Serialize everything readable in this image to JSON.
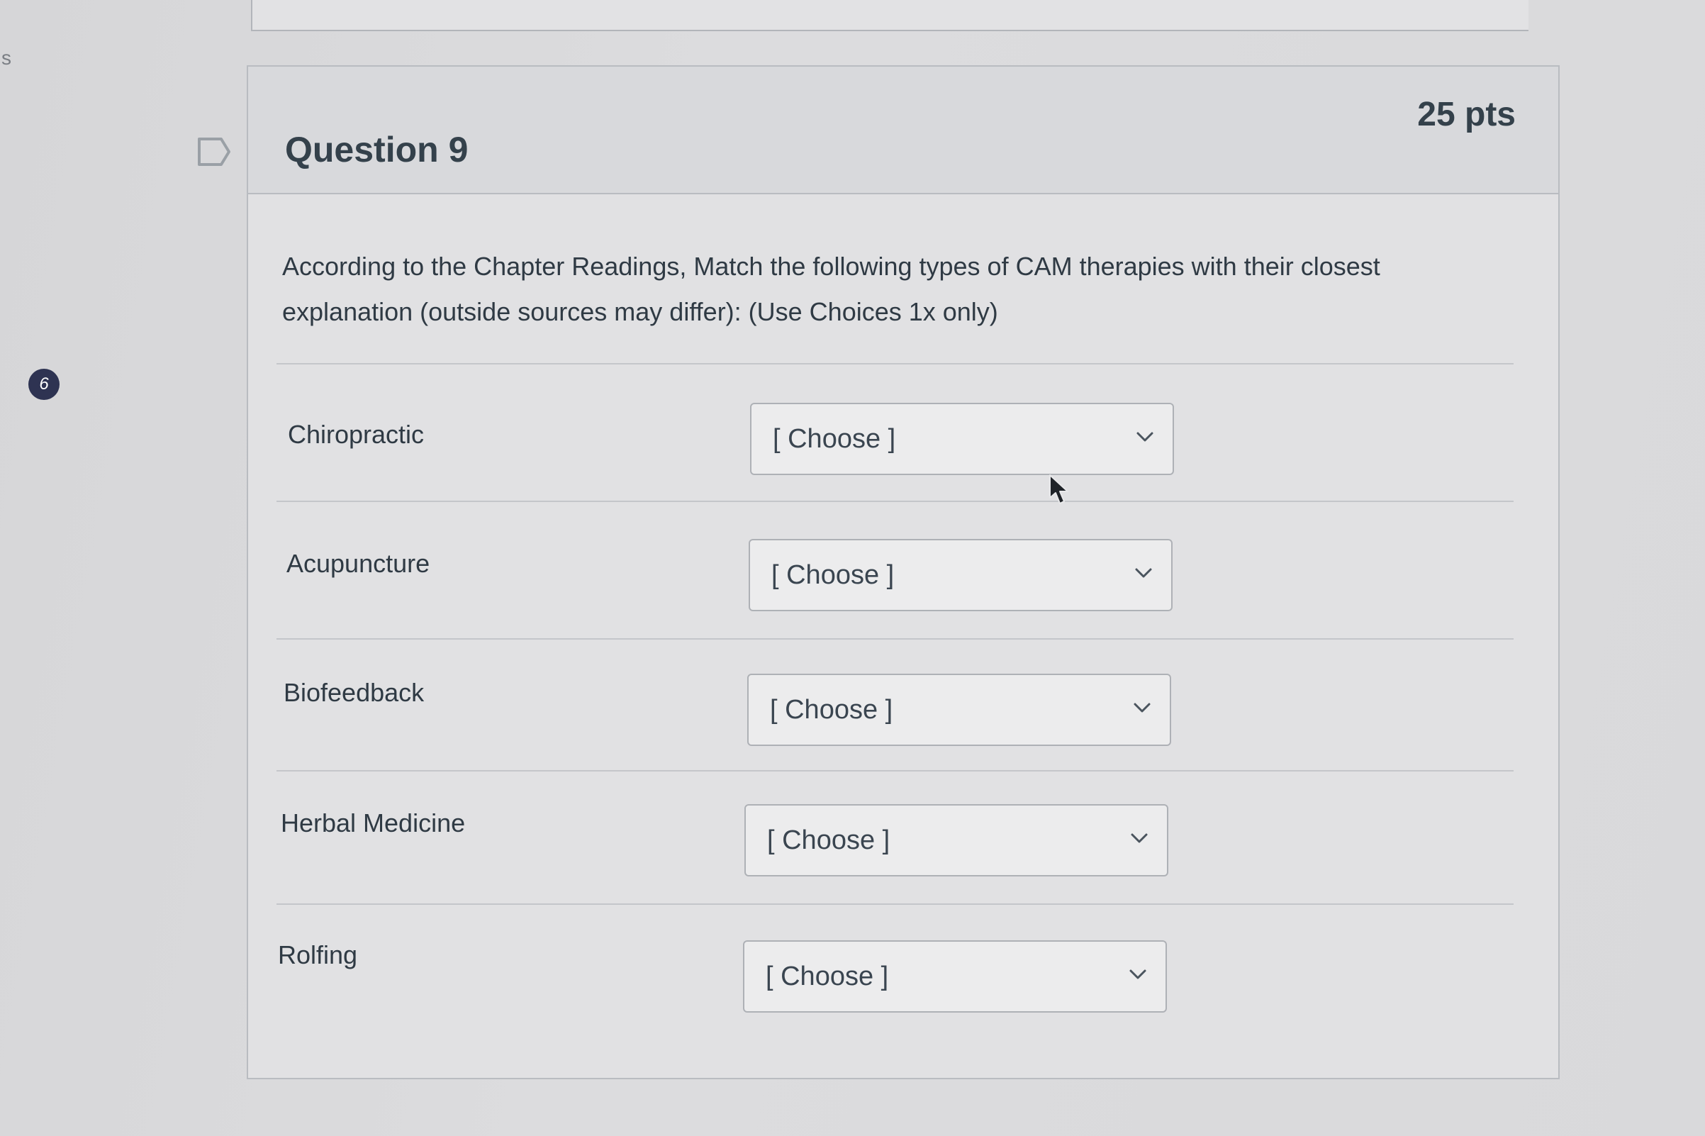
{
  "page": {
    "edge_letter": "s",
    "step_badge": "6"
  },
  "question": {
    "title": "Question 9",
    "points": "25 pts",
    "prompt": "According to the Chapter Readings, Match the following types of CAM therapies with their closest explanation (outside sources may differ): (Use Choices 1x only)",
    "flag_icon": "bookmark-flag-icon",
    "rows": [
      {
        "label": "Chiropractic",
        "selected": "[ Choose ]"
      },
      {
        "label": "Acupuncture",
        "selected": "[ Choose ]"
      },
      {
        "label": "Biofeedback",
        "selected": "[ Choose ]"
      },
      {
        "label": "Herbal Medicine",
        "selected": "[ Choose ]"
      },
      {
        "label": "Rolfing",
        "selected": "[ Choose ]"
      }
    ]
  }
}
